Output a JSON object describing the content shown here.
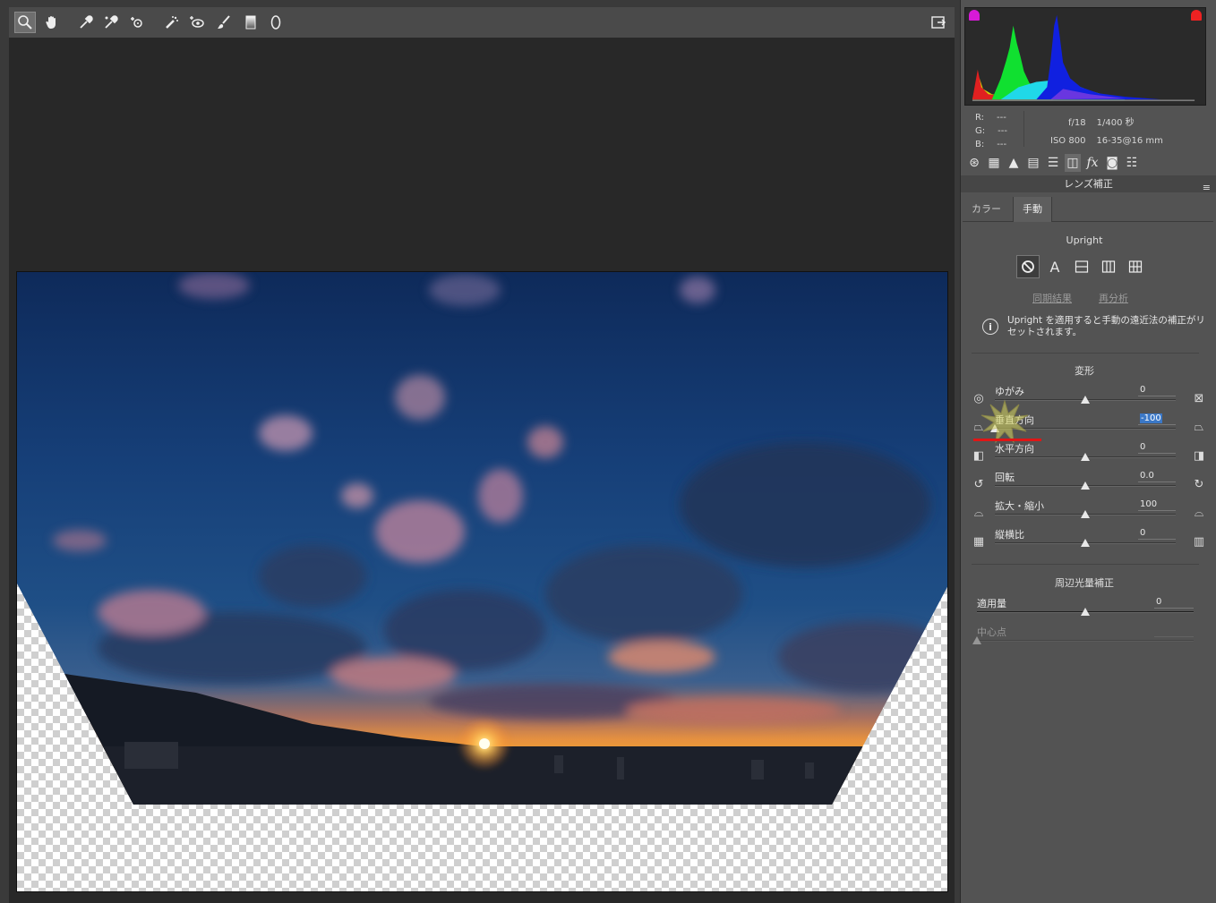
{
  "toolbar": {
    "tools": [
      {
        "name": "zoom-tool",
        "icon": "magnifier-icon",
        "active": true
      },
      {
        "name": "hand-tool",
        "icon": "hand-icon"
      },
      {
        "name": "white-balance-tool",
        "icon": "eyedropper-icon"
      },
      {
        "name": "color-sampler-tool",
        "icon": "color-sampler-icon"
      },
      {
        "name": "targeted-adjustment-tool",
        "icon": "target-adjust-icon"
      },
      {
        "name": "spot-removal-tool",
        "icon": "spot-removal-icon"
      },
      {
        "name": "red-eye-tool",
        "icon": "red-eye-icon"
      },
      {
        "name": "adjustment-brush-tool",
        "icon": "brush-icon"
      },
      {
        "name": "graduated-filter-tool",
        "icon": "graduated-filter-icon"
      },
      {
        "name": "radial-filter-tool",
        "icon": "radial-filter-icon"
      }
    ],
    "fullscreen_icon": "fullscreen-toggle-icon"
  },
  "histogram": {
    "shadow_clip_color": "#d81ad8",
    "highlight_clip_color": "#e22222"
  },
  "info": {
    "r_label": "R:",
    "r_value": "---",
    "g_label": "G:",
    "g_value": "---",
    "b_label": "B:",
    "b_value": "---",
    "aperture": "f/18",
    "shutter": "1/400 秒",
    "iso": "ISO 800",
    "lens": "16-35@16 mm"
  },
  "panel": {
    "title": "レンズ補正",
    "tabs": [
      {
        "label": "カラー",
        "active": false
      },
      {
        "label": "手動",
        "active": true
      }
    ],
    "upright": {
      "title": "Upright",
      "sync_link": "同期結果",
      "reanalyze_link": "再分析",
      "notice": "Upright を適用すると手動の遠近法の補正がリセットされます。"
    },
    "transform": {
      "title": "変形",
      "sliders": [
        {
          "label": "ゆがみ",
          "value": "0",
          "fraction": 0.5,
          "selected": false
        },
        {
          "label": "垂直方向",
          "value": "-100",
          "fraction": 0.0,
          "selected": true
        },
        {
          "label": "水平方向",
          "value": "0",
          "fraction": 0.5,
          "selected": false
        },
        {
          "label": "回転",
          "value": "0.0",
          "fraction": 0.5,
          "selected": false
        },
        {
          "label": "拡大・縮小",
          "value": "100",
          "fraction": 0.5,
          "selected": false
        },
        {
          "label": "縦横比",
          "value": "0",
          "fraction": 0.5,
          "selected": false
        }
      ]
    },
    "vignetting": {
      "title": "周辺光量補正",
      "amount_label": "適用量",
      "amount_value": "0",
      "amount_fraction": 0.5,
      "midpoint_label": "中心点",
      "midpoint_value": "",
      "midpoint_fraction": 0.0
    }
  }
}
